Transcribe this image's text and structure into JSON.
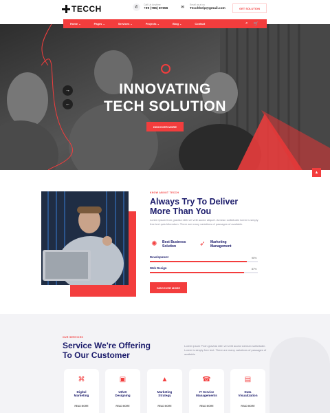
{
  "header": {
    "logo_text": "TECCH",
    "phone_label": "Call Us Anytime",
    "phone_number": "+99 (786) 87656",
    "email_label": "Email us at us",
    "email_address": "Tecchhelp@gmail.com",
    "cta_label": "GET SOLUTION"
  },
  "nav": {
    "items": [
      {
        "label": "Home ⌄"
      },
      {
        "label": "Pages ⌄"
      },
      {
        "label": "Services ⌄"
      },
      {
        "label": "Projects ⌄"
      },
      {
        "label": "Blog ⌄"
      },
      {
        "label": "Contact"
      }
    ]
  },
  "hero": {
    "title_line1": "INNOVATING",
    "title_line2": "TECH SOLUTION",
    "button_label": "DISCOVER MORE",
    "prev_arrow": "←",
    "next_arrow": "→"
  },
  "about": {
    "eyebrow": "KNOW ABOUT TECCH",
    "title_line1": "Always Try To Deliver",
    "title_line2": "More Than You",
    "paragraph": "Lorem ipsum from gravida nibh vel velit auctor aliquet. Aenean sollicitudin lorem is simply free text quis bibendum. There are many variations of passages of available.",
    "features": [
      {
        "icon": "lightbulb-icon",
        "label_line1": "Best Business",
        "label_line2": "Solution"
      },
      {
        "icon": "rocket-icon",
        "label_line1": "Marketing",
        "label_line2": "Management"
      }
    ],
    "skills": [
      {
        "label": "Development",
        "value_text": "90%",
        "value": 0.9
      },
      {
        "label": "Web Design",
        "value_text": "87%",
        "value": 0.87
      }
    ],
    "button_label": "DISCOVER MORE"
  },
  "services": {
    "eyebrow": "OUR SERVICES",
    "title_line1": "Service We're Offering",
    "title_line2": "To Our Customer",
    "paragraph": "Lorem ipsum Proin gravida nibh vel velit auctor Aenean sollicitudin. Lorem is simply free text. There are many variations of passages of available",
    "cards": [
      {
        "icon": "marketing-icon",
        "line1": "Digital",
        "line2": "Marketing",
        "more": "READ MORE"
      },
      {
        "icon": "design-icon",
        "line1": "UI/UX",
        "line2": "Designing",
        "more": "READ MORE"
      },
      {
        "icon": "chart-icon",
        "line1": "Marketing",
        "line2": "Strategy",
        "more": "READ MORE"
      },
      {
        "icon": "support-icon",
        "line1": "IT Service",
        "line2": "Managements",
        "more": "READ MORE"
      },
      {
        "icon": "data-icon",
        "line1": "Data",
        "line2": "Visualization",
        "more": "READ MORE"
      }
    ]
  },
  "colors": {
    "accent": "#f33d3d",
    "navy": "#1b1b6b",
    "section_bg": "#f3f3f6"
  }
}
